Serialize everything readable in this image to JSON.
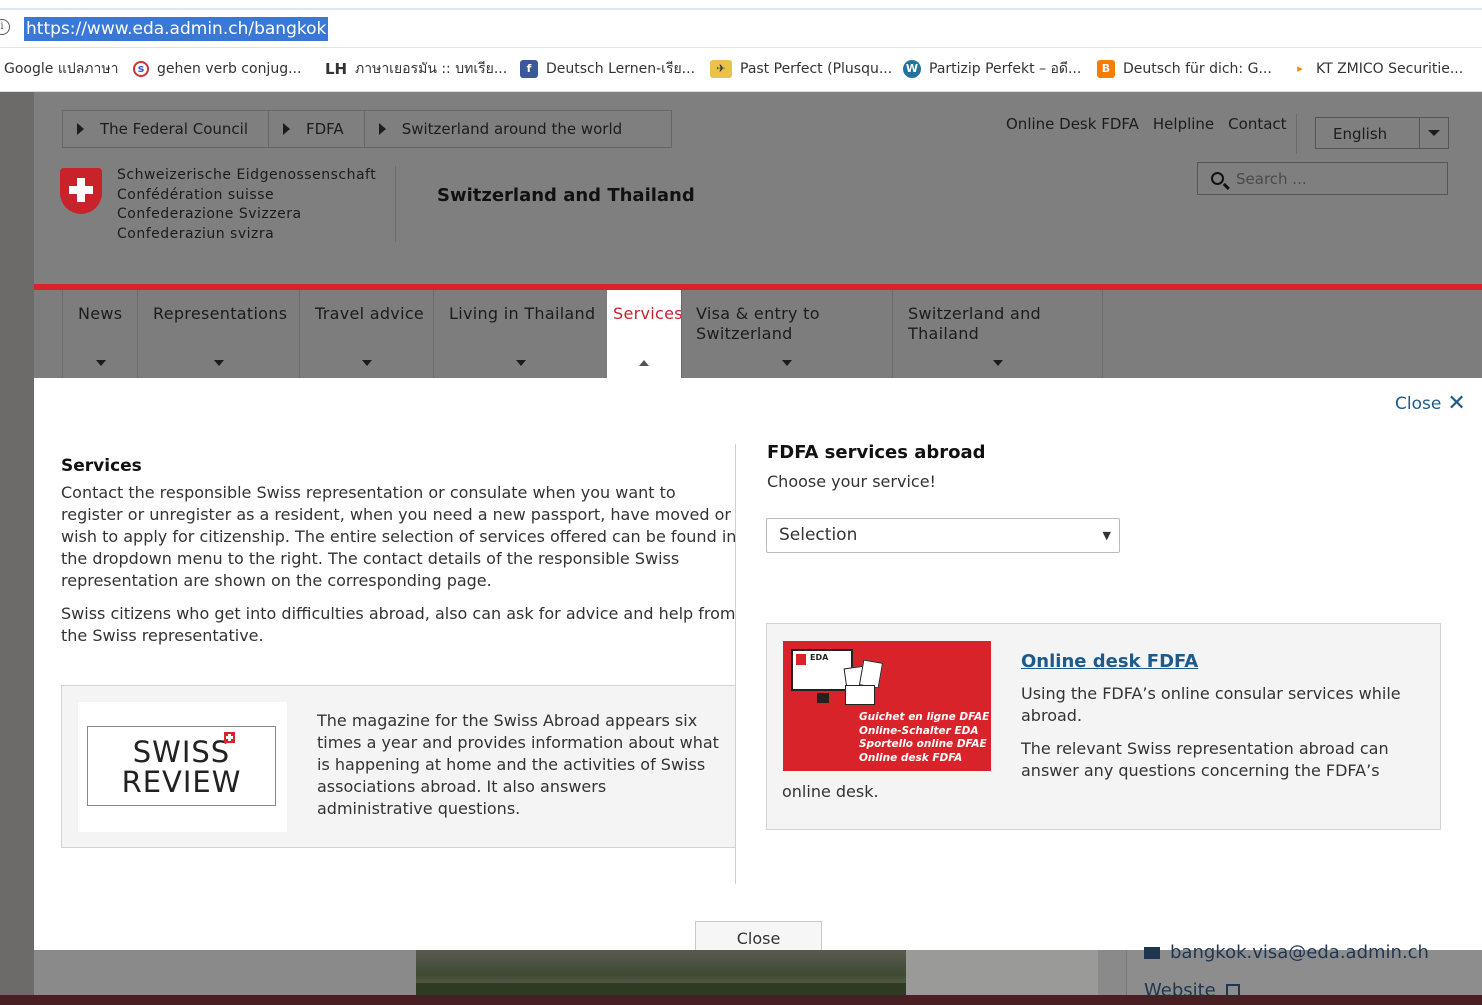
{
  "browser": {
    "url": "https://www.eda.admin.ch/bangkok",
    "bookmarks": [
      {
        "label": "Google แปลภาษา",
        "icon": "google-translate-icon"
      },
      {
        "label": "gehen verb conjug...",
        "icon": "conjugation-site-icon"
      },
      {
        "label": "ภาษาเยอรมัน :: บทเรีย...",
        "icon": "lh-site-icon"
      },
      {
        "label": "Deutsch Lernen-เรีย...",
        "icon": "facebook-icon"
      },
      {
        "label": "Past Perfect (Plusqu...",
        "icon": "bird-site-icon"
      },
      {
        "label": "Partizip Perfekt – อดี...",
        "icon": "wordpress-icon"
      },
      {
        "label": "Deutsch für dich: G...",
        "icon": "blogger-icon"
      },
      {
        "label": "KT ZMICO Securitie...",
        "icon": "zmico-icon"
      }
    ]
  },
  "header": {
    "breadcrumb": [
      "The Federal Council",
      "FDFA",
      "Switzerland around the world"
    ],
    "confederation": [
      "Schweizerische Eidgenossenschaft",
      "Confédération suisse",
      "Confederazione Svizzera",
      "Confederaziun svizra"
    ],
    "site_title": "Switzerland and Thailand",
    "service_links": [
      "Online Desk FDFA",
      "Helpline",
      "Contact"
    ],
    "language": "English",
    "search_placeholder": "Search ..."
  },
  "nav": {
    "items": [
      {
        "label": "News"
      },
      {
        "label": "Representations"
      },
      {
        "label": "Travel advice"
      },
      {
        "label": "Living in Thailand"
      },
      {
        "label": "Services"
      },
      {
        "label": "Visa & entry to Switzerland"
      },
      {
        "label": "Switzerland and Thailand"
      }
    ],
    "active": "Services"
  },
  "panel": {
    "close_label": "Close",
    "close_bottom_label": "Close",
    "services": {
      "title": "Services",
      "paragraphs": [
        "Contact the responsible Swiss representation or consulate when you want to register or unregister as a resident, when you need a new passport, have moved or wish to apply for citizenship. The entire selection of services offered can be found in the dropdown menu to the right. The contact details of the responsible Swiss representation are shown on the corresponding page.",
        "Swiss citizens who get into difficulties abroad, also can ask for advice and help from the Swiss representative."
      ]
    },
    "swiss_review": {
      "logo_line1": "SWISS",
      "logo_line2": "REVIEW",
      "text": "The magazine for the Swiss Abroad appears six times a year and provides information about what is happening at home and the activities of Swiss associations abroad. It also answers administrative questions."
    },
    "fdfa_services": {
      "title": "FDFA services abroad",
      "subtitle": "Choose your service!",
      "select_value": "Selection"
    },
    "online_desk": {
      "image_label": "EDA",
      "image_caption": [
        "Guichet en ligne DFAE",
        "Online-Schalter EDA",
        "Sportello online DFAE",
        "Online desk FDFA"
      ],
      "title": "Online desk FDFA",
      "paragraphs": [
        "Using the FDFA’s online consular services while abroad.",
        "The relevant Swiss representation abroad can answer any questions concerning the FDFA’s"
      ],
      "tail": "online desk."
    }
  },
  "background": {
    "contact_email": "bangkok.visa@eda.admin.ch",
    "website_label": "Website"
  },
  "colors": {
    "swiss_red": "#d8232a",
    "link_blue": "#1e5a8a",
    "url_highlight": "#3a78d6"
  }
}
